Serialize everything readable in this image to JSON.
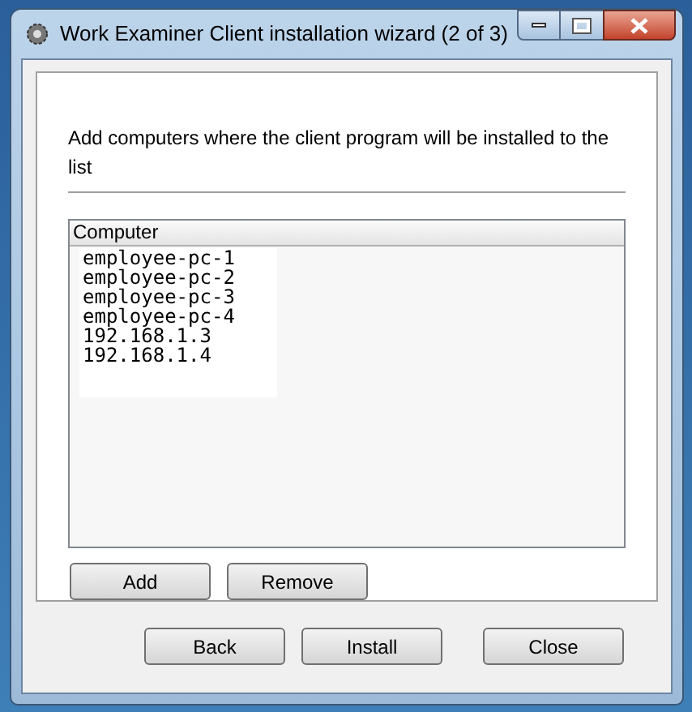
{
  "window": {
    "title": "Work Examiner Client installation wizard (2 of 3)"
  },
  "instruction": "Add computers where the client program will be installed to the list",
  "list": {
    "columns": [
      "Computer"
    ],
    "items": [
      "employee-pc-1",
      "employee-pc-2",
      "employee-pc-3",
      "employee-pc-4",
      "192.168.1.3",
      "192.168.1.4"
    ]
  },
  "list_buttons": [
    "Add",
    "Remove"
  ],
  "footer_buttons": [
    "Back",
    "Install",
    "Close"
  ]
}
